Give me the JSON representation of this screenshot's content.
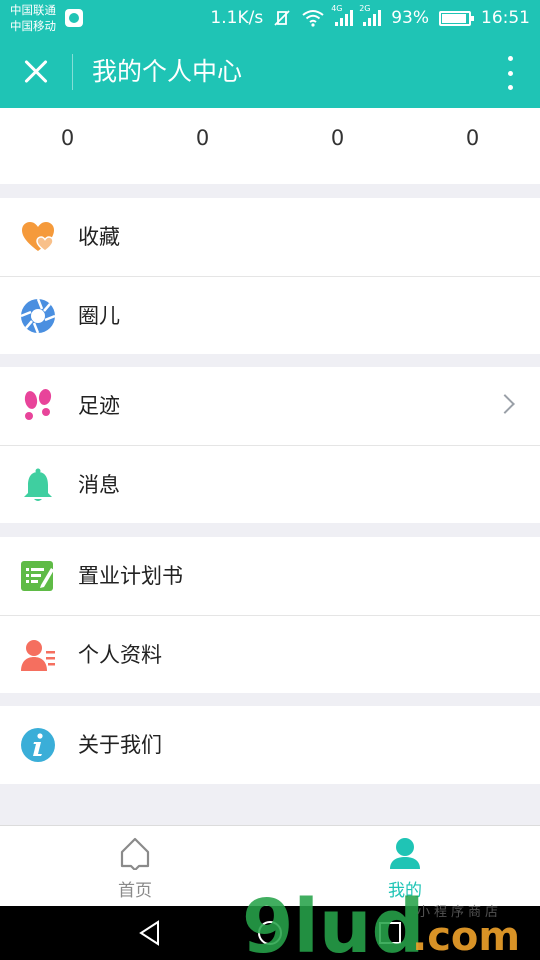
{
  "status_bar": {
    "carrier1": "中国联通",
    "carrier2": "中国移动",
    "speed": "1.1K/s",
    "net1": "4G",
    "net2": "2G",
    "battery": "93%",
    "time": "16:51"
  },
  "header": {
    "title": "我的个人中心",
    "close_icon": "close-icon",
    "more_icon": "more-vertical-icon"
  },
  "stats": [
    "0",
    "0",
    "0",
    "0"
  ],
  "menu_groups": [
    {
      "items": [
        {
          "label": "收藏",
          "icon": "heart-icon"
        },
        {
          "label": "圈儿",
          "icon": "aperture-icon"
        }
      ]
    },
    {
      "items": [
        {
          "label": "足迹",
          "icon": "footprints-icon"
        },
        {
          "label": "消息",
          "icon": "bell-icon"
        }
      ]
    },
    {
      "items": [
        {
          "label": "置业计划书",
          "icon": "plan-document-icon"
        },
        {
          "label": "个人资料",
          "icon": "profile-icon"
        }
      ]
    },
    {
      "items": [
        {
          "label": "关于我们",
          "icon": "info-icon"
        }
      ]
    }
  ],
  "tabbar": {
    "home_label": "首页",
    "mine_label": "我的"
  },
  "watermark": {
    "brand": "9lud",
    "domain": ".com",
    "tagline": "小程序商店"
  },
  "colors": {
    "primary": "#1fc4b5",
    "background": "#efeff4"
  }
}
